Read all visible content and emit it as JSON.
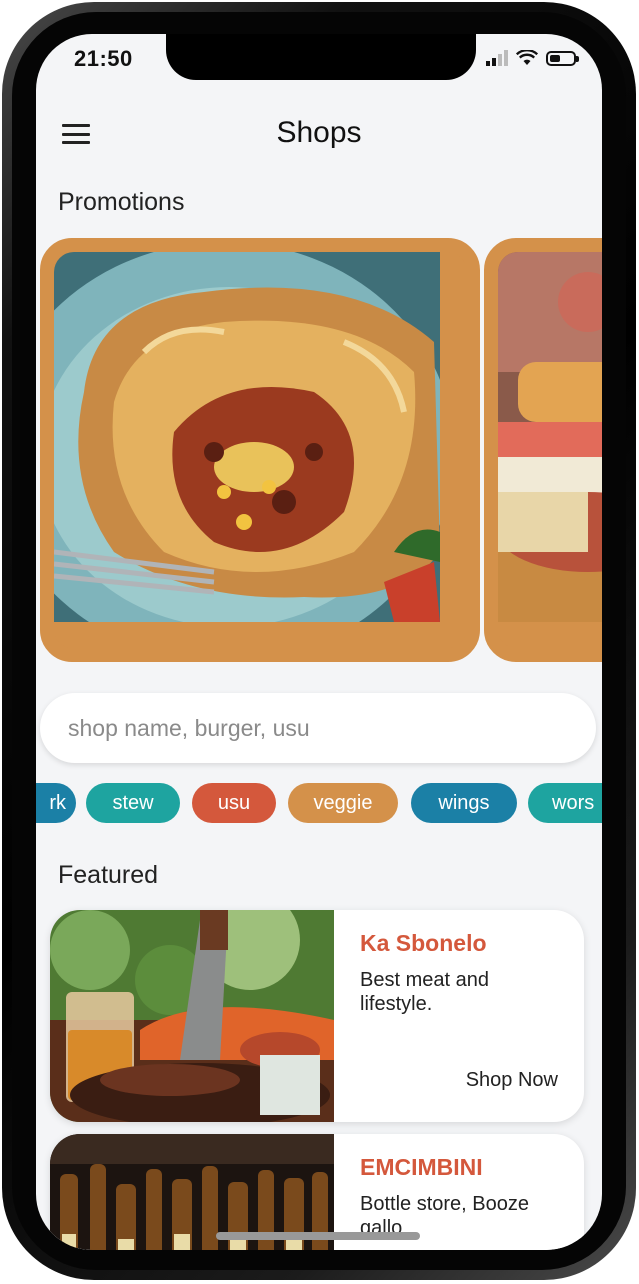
{
  "status_bar": {
    "time": "21:50"
  },
  "header": {
    "title": "Shops"
  },
  "promotions": {
    "title": "Promotions",
    "cards": [
      {
        "image": "pie-food-photo"
      },
      {
        "image": "sandwich-food-photo"
      }
    ]
  },
  "search": {
    "placeholder": "shop name, burger, usu"
  },
  "categories": [
    {
      "label": "rk",
      "color": "#1b80a6"
    },
    {
      "label": "stew",
      "color": "#1ea4a0"
    },
    {
      "label": "usu",
      "color": "#d4583c"
    },
    {
      "label": "veggie",
      "color": "#d4914a"
    },
    {
      "label": "wings",
      "color": "#1b80a6"
    },
    {
      "label": "wors",
      "color": "#1ea4a0"
    }
  ],
  "featured": {
    "title": "Featured",
    "shops": [
      {
        "name": "Ka Sbonelo",
        "description": "Best meat and lifestyle.",
        "cta": "Shop Now",
        "image": "braai-meat-photo"
      },
      {
        "name": "EMCIMBINI",
        "description": "Bottle store, Booze gallo",
        "image": "bottles-photo"
      }
    ]
  },
  "colors": {
    "accent": "#d4914a",
    "shop_name": "#d4583c",
    "teal": "#1ea4a0",
    "blue": "#1b80a6"
  }
}
